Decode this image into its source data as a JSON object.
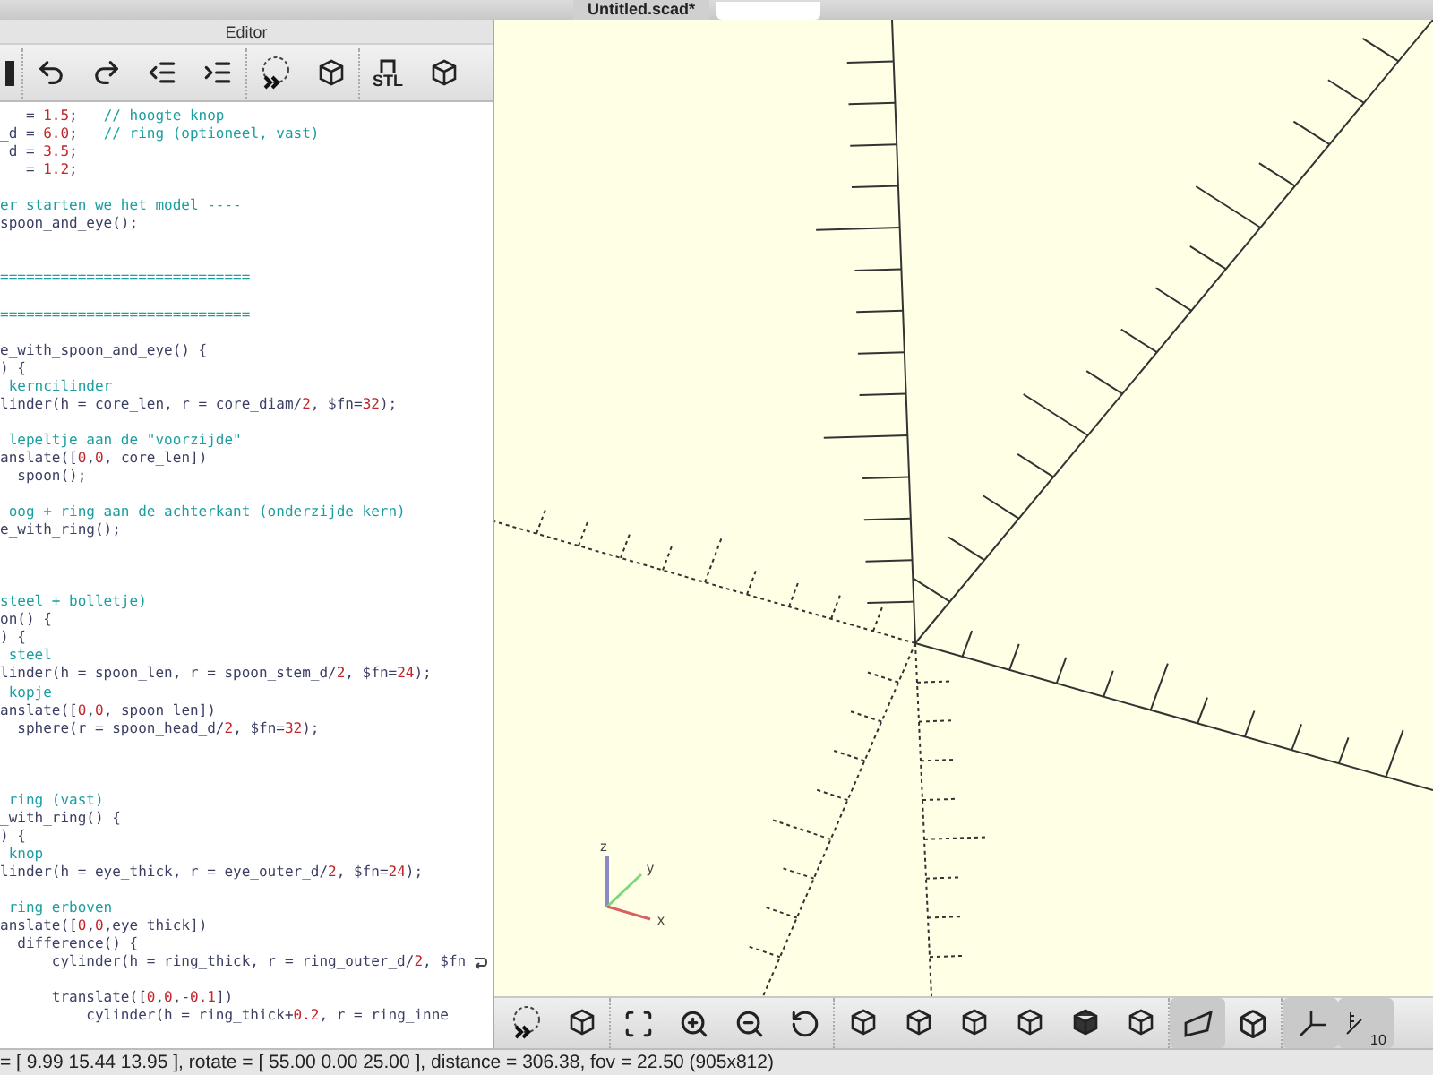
{
  "document_tab": {
    "title": "Untitled.scad*",
    "selected": true
  },
  "editor": {
    "title": "Editor",
    "toolbar": {
      "export_label": "STL"
    },
    "lines": [
      {
        "segments": [
          {
            "text": "   = ",
            "kind": "code"
          },
          {
            "text": "1.5",
            "kind": "num"
          },
          {
            "text": ";   ",
            "kind": "code"
          },
          {
            "text": "// hoogte knop",
            "kind": "cm"
          }
        ]
      },
      {
        "segments": [
          {
            "text": "_d = ",
            "kind": "code"
          },
          {
            "text": "6.0",
            "kind": "num"
          },
          {
            "text": ";   ",
            "kind": "code"
          },
          {
            "text": "// ring (optioneel, vast)",
            "kind": "cm"
          }
        ]
      },
      {
        "segments": [
          {
            "text": "_d = ",
            "kind": "code"
          },
          {
            "text": "3.5",
            "kind": "num"
          },
          {
            "text": ";",
            "kind": "code"
          }
        ]
      },
      {
        "segments": [
          {
            "text": "   = ",
            "kind": "code"
          },
          {
            "text": "1.2",
            "kind": "num"
          },
          {
            "text": ";",
            "kind": "code"
          }
        ]
      },
      {
        "kind": "blank"
      },
      {
        "segments": [
          {
            "text": "er starten we het model ----",
            "kind": "cm"
          }
        ]
      },
      {
        "segments": [
          {
            "text": "spoon_and_eye();",
            "kind": "code"
          }
        ]
      },
      {
        "kind": "blank"
      },
      {
        "kind": "blank"
      },
      {
        "segments": [
          {
            "text": "=============================",
            "kind": "cm"
          }
        ]
      },
      {
        "kind": "blank"
      },
      {
        "segments": [
          {
            "text": "=============================",
            "kind": "cm"
          }
        ]
      },
      {
        "kind": "blank"
      },
      {
        "segments": [
          {
            "text": "e_with_spoon_and_eye() {",
            "kind": "code"
          }
        ]
      },
      {
        "segments": [
          {
            "text": ") {",
            "kind": "code"
          }
        ]
      },
      {
        "segments": [
          {
            "text": " kerncilinder",
            "kind": "cm"
          }
        ]
      },
      {
        "segments": [
          {
            "text": "linder(h = core_len, r = core_diam/",
            "kind": "code"
          },
          {
            "text": "2",
            "kind": "num"
          },
          {
            "text": ", $fn=",
            "kind": "code"
          },
          {
            "text": "32",
            "kind": "num"
          },
          {
            "text": ");",
            "kind": "code"
          }
        ]
      },
      {
        "kind": "blank"
      },
      {
        "segments": [
          {
            "text": " lepeltje aan de \"voorzijde\"",
            "kind": "cm"
          }
        ]
      },
      {
        "segments": [
          {
            "text": "anslate([",
            "kind": "code"
          },
          {
            "text": "0",
            "kind": "num"
          },
          {
            "text": ",",
            "kind": "code"
          },
          {
            "text": "0",
            "kind": "num"
          },
          {
            "text": ", core_len])",
            "kind": "code"
          }
        ]
      },
      {
        "segments": [
          {
            "text": "  spoon();",
            "kind": "code"
          }
        ]
      },
      {
        "kind": "blank"
      },
      {
        "segments": [
          {
            "text": " oog + ring aan de achterkant (onderzijde kern)",
            "kind": "cm"
          }
        ]
      },
      {
        "segments": [
          {
            "text": "e_with_ring();",
            "kind": "code"
          }
        ]
      },
      {
        "kind": "blank"
      },
      {
        "kind": "blank"
      },
      {
        "kind": "blank"
      },
      {
        "segments": [
          {
            "text": "steel + bolletje)",
            "kind": "cm"
          }
        ]
      },
      {
        "segments": [
          {
            "text": "on() {",
            "kind": "code"
          }
        ]
      },
      {
        "segments": [
          {
            "text": ") {",
            "kind": "code"
          }
        ]
      },
      {
        "segments": [
          {
            "text": " steel",
            "kind": "cm"
          }
        ]
      },
      {
        "segments": [
          {
            "text": "linder(h = spoon_len, r = spoon_stem_d/",
            "kind": "code"
          },
          {
            "text": "2",
            "kind": "num"
          },
          {
            "text": ", $fn=",
            "kind": "code"
          },
          {
            "text": "24",
            "kind": "num"
          },
          {
            "text": ");",
            "kind": "code"
          }
        ]
      },
      {
        "segments": [
          {
            "text": " kopje",
            "kind": "cm"
          }
        ]
      },
      {
        "segments": [
          {
            "text": "anslate([",
            "kind": "code"
          },
          {
            "text": "0",
            "kind": "num"
          },
          {
            "text": ",",
            "kind": "code"
          },
          {
            "text": "0",
            "kind": "num"
          },
          {
            "text": ", spoon_len])",
            "kind": "code"
          }
        ]
      },
      {
        "segments": [
          {
            "text": "  sphere(r = spoon_head_d/",
            "kind": "code"
          },
          {
            "text": "2",
            "kind": "num"
          },
          {
            "text": ", $fn=",
            "kind": "code"
          },
          {
            "text": "32",
            "kind": "num"
          },
          {
            "text": ");",
            "kind": "code"
          }
        ]
      },
      {
        "kind": "blank"
      },
      {
        "kind": "blank"
      },
      {
        "kind": "blank"
      },
      {
        "segments": [
          {
            "text": " ring (vast)",
            "kind": "cm"
          }
        ]
      },
      {
        "segments": [
          {
            "text": "_with_ring() {",
            "kind": "code"
          }
        ]
      },
      {
        "segments": [
          {
            "text": ") {",
            "kind": "code"
          }
        ]
      },
      {
        "segments": [
          {
            "text": " knop",
            "kind": "cm"
          }
        ]
      },
      {
        "segments": [
          {
            "text": "linder(h = eye_thick, r = eye_outer_d/",
            "kind": "code"
          },
          {
            "text": "2",
            "kind": "num"
          },
          {
            "text": ", $fn=",
            "kind": "code"
          },
          {
            "text": "24",
            "kind": "num"
          },
          {
            "text": ");",
            "kind": "code"
          }
        ]
      },
      {
        "kind": "blank"
      },
      {
        "segments": [
          {
            "text": " ring erboven",
            "kind": "cm"
          }
        ]
      },
      {
        "segments": [
          {
            "text": "anslate([",
            "kind": "code"
          },
          {
            "text": "0",
            "kind": "num"
          },
          {
            "text": ",",
            "kind": "code"
          },
          {
            "text": "0",
            "kind": "num"
          },
          {
            "text": ",eye_thick])",
            "kind": "code"
          }
        ]
      },
      {
        "segments": [
          {
            "text": "  difference() {",
            "kind": "code"
          }
        ]
      },
      {
        "segments": [
          {
            "text": "      cylinder(h = ring_thick, r = ring_outer_d/",
            "kind": "code"
          },
          {
            "text": "2",
            "kind": "num"
          },
          {
            "text": ", $fn",
            "kind": "code"
          }
        ],
        "wrapped": true
      },
      {
        "kind": "blank"
      },
      {
        "segments": [
          {
            "text": "      translate([",
            "kind": "code"
          },
          {
            "text": "0",
            "kind": "num"
          },
          {
            "text": ",",
            "kind": "code"
          },
          {
            "text": "0",
            "kind": "num"
          },
          {
            "text": ",-",
            "kind": "code"
          },
          {
            "text": "0.1",
            "kind": "num"
          },
          {
            "text": "])",
            "kind": "code"
          }
        ]
      },
      {
        "segments": [
          {
            "text": "          cylinder(h = ring_thick+",
            "kind": "code"
          },
          {
            "text": "0.2",
            "kind": "num"
          },
          {
            "text": ", r = ring_inne",
            "kind": "code"
          }
        ]
      }
    ]
  },
  "viewport": {
    "gizmo_labels": [
      "x",
      "y",
      "z"
    ],
    "projection": [
      {
        "selected": true
      },
      {
        "selected": false
      }
    ],
    "show_axes": {
      "on": true
    },
    "show_scale": {
      "on": true,
      "label": "10"
    }
  },
  "status_bar": "= [ 9.99 15.44 13.95 ], rotate = [ 55.00 0.00 25.00 ], distance = 306.38, fov = 22.50 (905x812)"
}
